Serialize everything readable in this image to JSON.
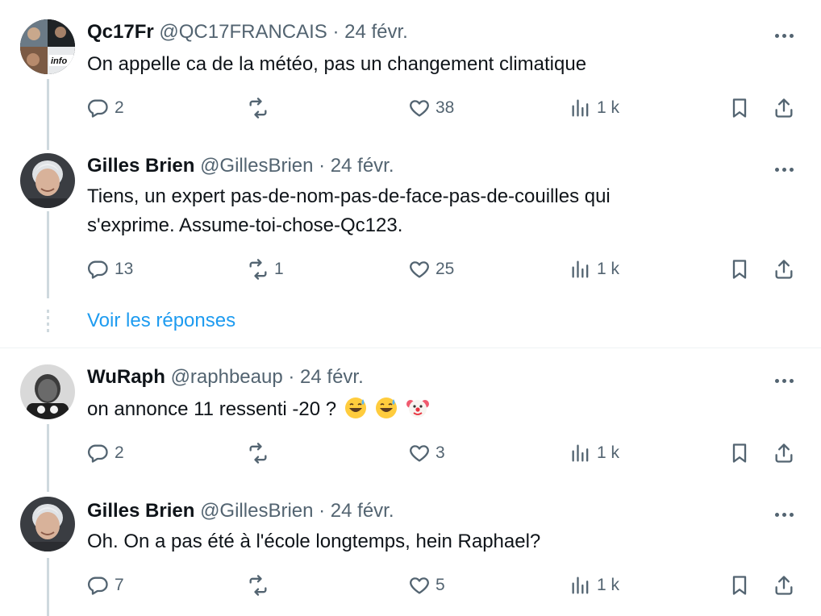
{
  "tweets": [
    {
      "name": "Qc17Fr",
      "handle": "@QC17FRANCAIS",
      "date": "· 24 févr.",
      "text": "On appelle ca de la météo,  pas un changement climatique",
      "avatar_text": "info",
      "replies": "2",
      "reposts": "",
      "likes": "38",
      "views": "1 k"
    },
    {
      "name": "Gilles Brien",
      "handle": "@GillesBrien",
      "date": "· 24 févr.",
      "text_line1": "Tiens, un expert pas-de-nom-pas-de-face-pas-de-couilles qui",
      "text_line2": "s'exprime. Assume-toi-chose-Qc123.",
      "replies": "13",
      "reposts": "1",
      "likes": "25",
      "views": "1 k"
    },
    {
      "name": "WuRaph",
      "handle": "@raphbeaup",
      "date": "· 24 févr.",
      "text": "on annonce 11 ressenti -20 ?",
      "emojis": [
        "grinning-sweat-emoji",
        "grinning-sweat-emoji",
        "clown-emoji"
      ],
      "replies": "2",
      "reposts": "",
      "likes": "3",
      "views": "1 k"
    },
    {
      "name": "Gilles Brien",
      "handle": "@GillesBrien",
      "date": "· 24 févr.",
      "text": "Oh. On a pas été à l'école longtemps, hein Raphael?",
      "replies": "7",
      "reposts": "",
      "likes": "5",
      "views": "1 k"
    }
  ],
  "show_replies_label": "Voir les réponses",
  "colors": {
    "text": "#0f1419",
    "secondary": "#536471",
    "link": "#1d9bf0",
    "thread_line": "#cfd9de"
  }
}
